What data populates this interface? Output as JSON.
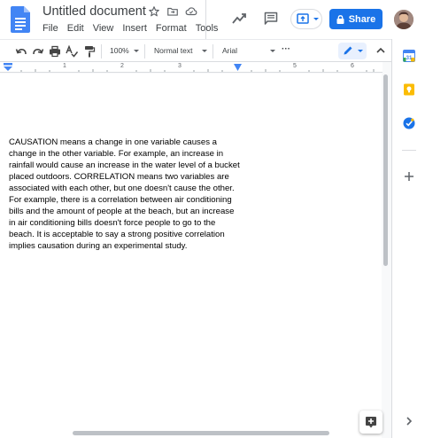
{
  "header": {
    "doc_title": "Untitled document",
    "menu": [
      "File",
      "Edit",
      "View",
      "Insert",
      "Format",
      "Tools"
    ],
    "share_label": "Share"
  },
  "toolbar": {
    "zoom": "100%",
    "style": "Normal text",
    "font": "Arial",
    "more": "···"
  },
  "ruler": {
    "numbers": [
      "1",
      "2",
      "3",
      "4",
      "5",
      "6"
    ]
  },
  "document": {
    "paragraph": "CAUSATION means a change in one variable causes a change in the other variable.  For example, an increase in rainfall would cause an increase in the water level of a bucket placed outdoors.  CORRELATION means two variables are associated with each other, but one doesn't cause the other.  For example, there is a correlation between air conditioning bills and the amount of people at the beach, but an increase in air conditioning bills doesn't force people to go to the beach.  It is acceptable to say a strong positive correlation implies causation during an experimental study."
  },
  "colors": {
    "share_blue": "#1a73e8",
    "docs_blue": "#4285f4",
    "keep_yellow": "#fbbc04",
    "calendar_blue": "#4285f4",
    "tasks_blue": "#1a73e8"
  },
  "icons": [
    "docs-logo-icon",
    "star-icon",
    "move-to-folder-icon",
    "cloud-status-icon",
    "activity-trend-icon",
    "comments-icon",
    "present-icon",
    "lock-icon",
    "undo-icon",
    "redo-icon",
    "print-icon",
    "spellcheck-icon",
    "paint-format-icon",
    "pencil-icon",
    "chevron-up-icon",
    "calendar-icon",
    "keep-icon",
    "tasks-icon",
    "add-icon",
    "chevron-right-icon",
    "explore-icon"
  ]
}
